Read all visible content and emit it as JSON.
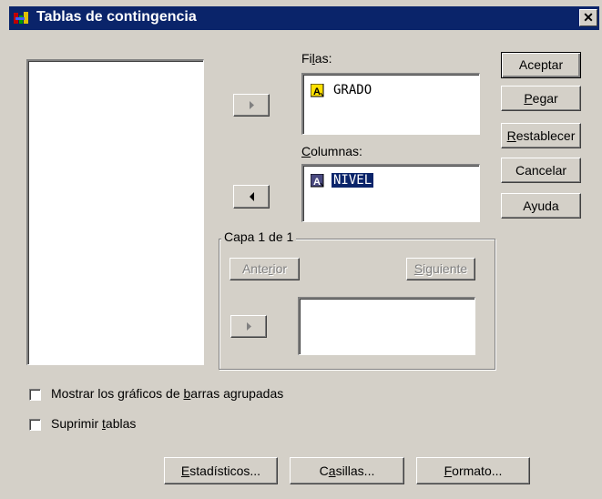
{
  "window": {
    "title": "Tablas de contingencia"
  },
  "labels": {
    "filas_pre": "Fi",
    "filas_key": "l",
    "filas_post": "as:",
    "columnas_key": "C",
    "columnas_post": "olumnas:",
    "capa": "Capa 1 de 1"
  },
  "rows_list": [
    {
      "name": "GRADO",
      "icon": "nominal-variable-icon"
    }
  ],
  "columns_list": [
    {
      "name": "NIVEL",
      "icon": "nominal-variable-icon",
      "selected": true
    }
  ],
  "buttons": {
    "aceptar": "Aceptar",
    "pegar_key": "P",
    "pegar_post": "egar",
    "restablecer_key": "R",
    "restablecer_post": "establecer",
    "cancelar": "Cancelar",
    "ayuda": "Ayuda",
    "anterior_pre": "Ante",
    "anterior_key": "r",
    "anterior_post": "ior",
    "siguiente_key": "S",
    "siguiente_post": "iguiente",
    "estadisticos_key": "E",
    "estadisticos_post": "stadísticos...",
    "casillas_pre": "C",
    "casillas_key": "a",
    "casillas_post": "sillas...",
    "formato_key": "F",
    "formato_post": "ormato..."
  },
  "checkboxes": {
    "barras_pre": "Mostrar los gráficos de ",
    "barras_key": "b",
    "barras_post": "arras agrupadas",
    "barras_checked": false,
    "suprimir_pre": "Suprimir ",
    "suprimir_key": "t",
    "suprimir_post": "ablas",
    "suprimir_checked": false
  },
  "colors": {
    "face": "#d4d0c8",
    "titlebar": "#0a246a",
    "selection": "#0a246a"
  }
}
